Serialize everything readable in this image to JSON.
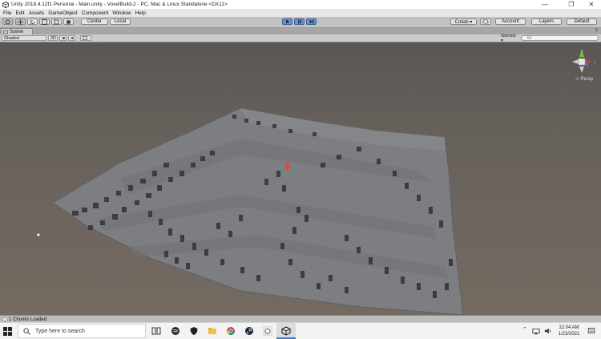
{
  "window": {
    "title": "Unity 2018.4.12f1 Personal - Main.unity - VoxelBuild-2 - PC, Mac & Linux Standalone <DX11>",
    "minimize": "—",
    "maximize": "❐",
    "close": "✕"
  },
  "menu": {
    "items": [
      "File",
      "Edit",
      "Assets",
      "GameObject",
      "Component",
      "Window",
      "Help"
    ]
  },
  "toolbar": {
    "pivot_label": "Center",
    "space_label": "Local",
    "collab_label": "Collab ▾",
    "account_label": "Account",
    "layers_label": "Layers",
    "layout_label": "Default"
  },
  "scene": {
    "tab_label": "Scene",
    "shading_mode": "Shaded",
    "mode_2d": "2D",
    "gizmos_label": "Gizmos ▾",
    "search_placeholder": "All",
    "persp_label": "≺ Persp"
  },
  "status": {
    "message": "1 Chunks Loaded"
  },
  "taskbar": {
    "search_placeholder": "Type here to search",
    "time": "12:04 AM",
    "date": "1/23/2021"
  },
  "colors": {
    "terrain": "#7e8083",
    "terrain_dark": "#6a6c6f",
    "voxel_shadow": "#3b3d40",
    "player_marker": "#e0463f",
    "play_button": "#6f93c9"
  }
}
